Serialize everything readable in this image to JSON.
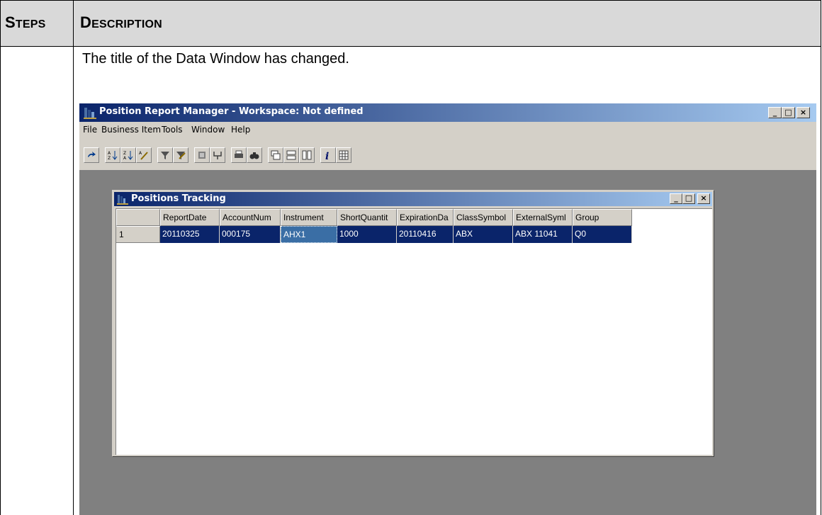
{
  "doc": {
    "header_steps_first": "S",
    "header_steps_rest": "TEPS",
    "header_desc_first": "D",
    "header_desc_rest": "ESCRIPTION",
    "description": "The title of the Data Window has changed."
  },
  "app": {
    "title": "Position Report Manager - Workspace: Not defined",
    "controls": {
      "minimize": "_",
      "maximize": "□",
      "close": "×"
    },
    "menu": [
      "File",
      "Business Item",
      "Tools",
      "Window",
      "Help"
    ],
    "toolbar_icons": [
      "refresh-icon",
      "sort-ascending-icon",
      "sort-descending-icon",
      "sort-custom-icon",
      "filter-icon",
      "filter-custom-icon",
      "group-icon",
      "pivot-icon",
      "print-icon",
      "find-icon",
      "tile-cascade-icon",
      "tile-horizontal-icon",
      "tile-vertical-icon",
      "info-icon",
      "grid-icon"
    ]
  },
  "child": {
    "title": "Positions Tracking",
    "columns": [
      "ReportDate",
      "AccountNum",
      "Instrument",
      "ShortQuantit",
      "ExpirationDa",
      "ClassSymbol",
      "ExternalSyml",
      "Group"
    ],
    "row_number": "1",
    "row": [
      "20110325",
      "000175",
      "AHX1",
      "1000",
      "20110416",
      "ABX",
      "ABX  11041",
      "Q0"
    ],
    "selection_color": "#0a246a",
    "focus_color": "#3a6ea5"
  }
}
